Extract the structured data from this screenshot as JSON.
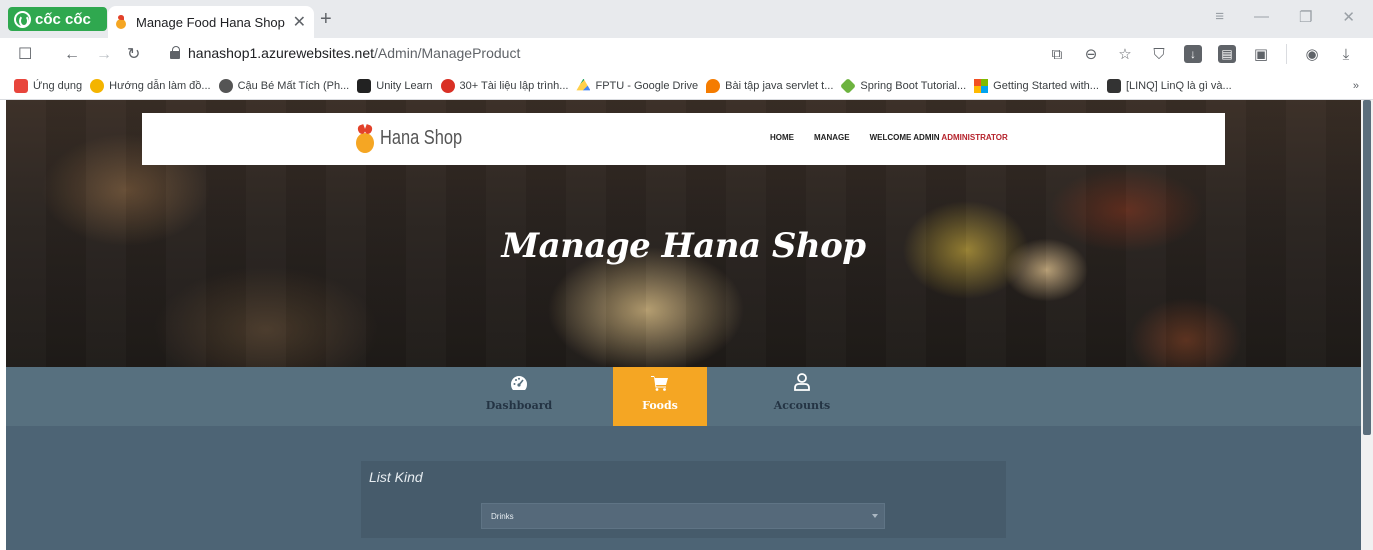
{
  "browser": {
    "brand": "cốc cốc",
    "tab": {
      "title": "Manage Food Hana Shop"
    },
    "new_tab_label": "+",
    "url": {
      "host": "hanashop1.azurewebsites.net",
      "path": "/Admin/ManageProduct"
    },
    "bookmarks": [
      {
        "label": "Ứng dụng",
        "icon": "apps-grid-icon",
        "color": "#e8453c"
      },
      {
        "label": "Hướng dẫn làm đồ...",
        "icon": "tutorial-icon",
        "color": "#f4b400"
      },
      {
        "label": "Cậu Bé Mất Tích (Ph...",
        "icon": "film-icon",
        "color": "#555555"
      },
      {
        "label": "Unity Learn",
        "icon": "unity-icon",
        "color": "#222222"
      },
      {
        "label": "30+ Tài liệu lập trình...",
        "icon": "topdev-icon",
        "color": "#d93025"
      },
      {
        "label": "FPTU - Google Drive",
        "icon": "google-drive-icon",
        "color": "#1fa463"
      },
      {
        "label": "Bài tập java servlet t...",
        "icon": "flame-icon",
        "color": "#f57c00"
      },
      {
        "label": "Spring Boot Tutorial...",
        "icon": "spring-icon",
        "color": "#6db33f"
      },
      {
        "label": "Getting Started with...",
        "icon": "microsoft-icon",
        "color": "#f25022"
      },
      {
        "label": "[LINQ] LinQ là gì và...",
        "icon": "linq-icon",
        "color": "#333333"
      }
    ],
    "bookmarks_more": "»"
  },
  "site": {
    "logo_text": "Hana Shop",
    "nav": {
      "home": "HOME",
      "manage": "MANAGE",
      "welcome": "WELCOME ADMIN",
      "username": "ADMINISTRATOR"
    },
    "hero_title": "Manage Hana Shop",
    "feature_tabs": [
      {
        "label": "Dashboard",
        "icon": "speedometer-icon",
        "active": false
      },
      {
        "label": "Foods",
        "icon": "shopping-cart-icon",
        "active": true
      },
      {
        "label": "Accounts",
        "icon": "user-icon",
        "active": false
      }
    ],
    "list_kind": {
      "title": "List Kind",
      "selected": "Drinks"
    }
  },
  "colors": {
    "accent": "#f5a623",
    "band": "#57707f",
    "main": "#4d6475",
    "admin_red": "#b5222b",
    "brand_green": "#2fa84f"
  }
}
